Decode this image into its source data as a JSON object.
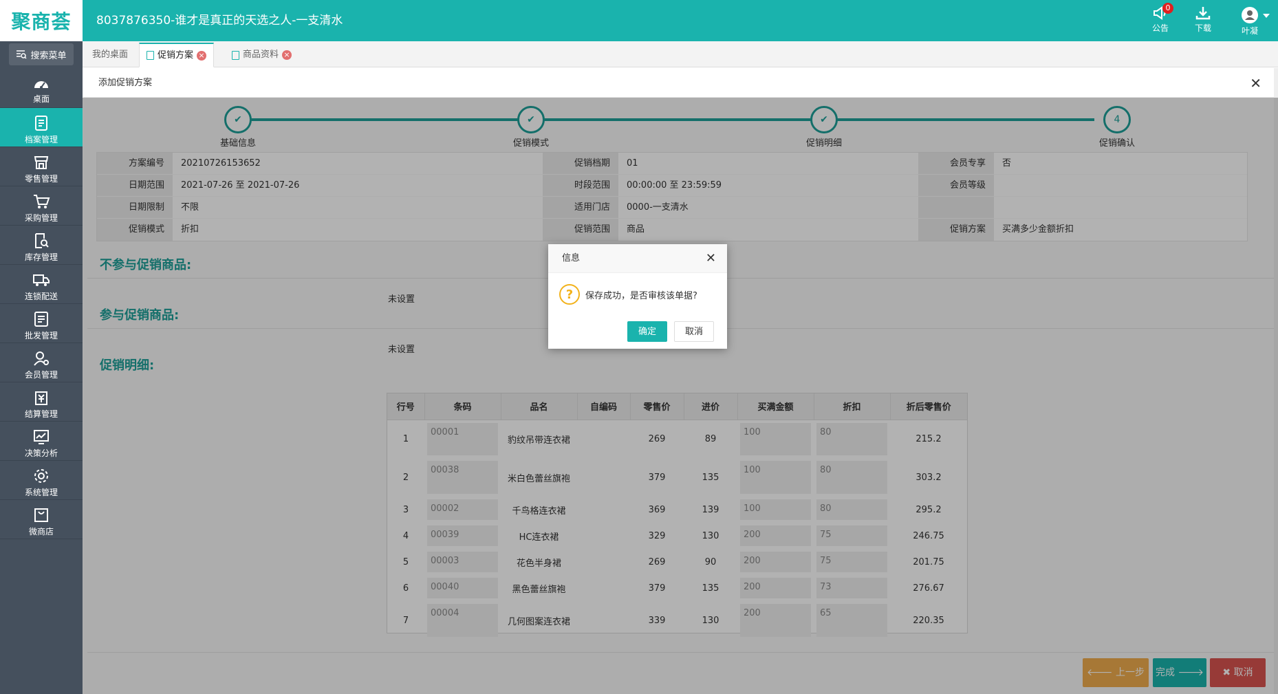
{
  "app": {
    "logo_text": "聚商荟",
    "title": "8037876350-谁才是真正的天选之人-一支清水",
    "announce_label": "公告",
    "announce_count": "0",
    "download_label": "下载",
    "user_name": "叶凝"
  },
  "sidebar": {
    "search_label": "搜索菜单",
    "items": [
      {
        "label": "桌面",
        "icon": "dashboard-icon"
      },
      {
        "label": "档案管理",
        "icon": "archive-icon"
      },
      {
        "label": "零售管理",
        "icon": "store-icon"
      },
      {
        "label": "采购管理",
        "icon": "cart-icon"
      },
      {
        "label": "库存管理",
        "icon": "inventory-icon"
      },
      {
        "label": "连锁配送",
        "icon": "truck-icon"
      },
      {
        "label": "批发管理",
        "icon": "wholesale-icon"
      },
      {
        "label": "会员管理",
        "icon": "member-icon"
      },
      {
        "label": "结算管理",
        "icon": "settlement-icon"
      },
      {
        "label": "决策分析",
        "icon": "analysis-icon"
      },
      {
        "label": "系统管理",
        "icon": "settings-icon"
      },
      {
        "label": "微商店",
        "icon": "shop-bag-icon"
      }
    ]
  },
  "tabs": [
    {
      "label": "我的桌面"
    },
    {
      "label": "促销方案"
    },
    {
      "label": "商品资料"
    }
  ],
  "panel": {
    "title": "添加促销方案",
    "steps": [
      {
        "label": "基础信息",
        "mark": "✔"
      },
      {
        "label": "促销模式",
        "mark": "✔"
      },
      {
        "label": "促销明细",
        "mark": "✔"
      },
      {
        "label": "促销确认",
        "mark": "4"
      }
    ],
    "info": {
      "r1": {
        "l1": "方案编号",
        "v1": "20210726153652",
        "l2": "促销档期",
        "v2": "01",
        "l3": "会员专享",
        "v3": "否"
      },
      "r2": {
        "l1": "日期范围",
        "v1": "2021-07-26 至 2021-07-26",
        "l2": "时段范围",
        "v2": "00:00:00 至 23:59:59",
        "l3": "会员等级",
        "v3": ""
      },
      "r3": {
        "l1": "日期限制",
        "v1": "不限",
        "l2": "适用门店",
        "v2": "0000-一支清水",
        "l3": "",
        "v3": ""
      },
      "r4": {
        "l1": "促销模式",
        "v1": "折扣",
        "l2": "促销范围",
        "v2": "商品",
        "l3": "促销方案",
        "v3": "买满多少金额折扣"
      }
    },
    "excluded_title": "不参与促销商品:",
    "excluded_value": "未设置",
    "included_title": "参与促销商品:",
    "included_value": "未设置",
    "detail_title": "促销明细:",
    "table": {
      "headers": [
        "行号",
        "条码",
        "品名",
        "自编码",
        "零售价",
        "进价",
        "买满金额",
        "折扣",
        "折后零售价"
      ],
      "rows": [
        {
          "no": "1",
          "barcode": "00001",
          "name": "豹纹吊带连衣裙",
          "code": "",
          "retail": "269",
          "cost": "89",
          "min": "100",
          "discount": "80",
          "final": "215.2"
        },
        {
          "no": "2",
          "barcode": "00038",
          "name": "米白色蕾丝旗袍",
          "code": "",
          "retail": "379",
          "cost": "135",
          "min": "100",
          "discount": "80",
          "final": "303.2"
        },
        {
          "no": "3",
          "barcode": "00002",
          "name": "千鸟格连衣裙",
          "code": "",
          "retail": "369",
          "cost": "139",
          "min": "100",
          "discount": "80",
          "final": "295.2"
        },
        {
          "no": "4",
          "barcode": "00039",
          "name": "HC连衣裙",
          "code": "",
          "retail": "329",
          "cost": "130",
          "min": "200",
          "discount": "75",
          "final": "246.75"
        },
        {
          "no": "5",
          "barcode": "00003",
          "name": "花色半身裙",
          "code": "",
          "retail": "269",
          "cost": "90",
          "min": "200",
          "discount": "75",
          "final": "201.75"
        },
        {
          "no": "6",
          "barcode": "00040",
          "name": "黑色蕾丝旗袍",
          "code": "",
          "retail": "379",
          "cost": "135",
          "min": "200",
          "discount": "73",
          "final": "276.67"
        },
        {
          "no": "7",
          "barcode": "00004",
          "name": "几何图案连衣裙",
          "code": "",
          "retail": "339",
          "cost": "130",
          "min": "200",
          "discount": "65",
          "final": "220.35"
        }
      ]
    },
    "buttons": {
      "prev": "上一步",
      "finish": "完成",
      "cancel": "取消"
    }
  },
  "dialog": {
    "title": "信息",
    "message": "保存成功，是否审核该单据?",
    "ok_label": "确定",
    "cancel_label": "取消"
  },
  "colors": {
    "brand": "#1ab3ad",
    "sidebar_bg": "#45505d",
    "step_color": "#1e9f99",
    "prev_button": "#f0ad4e",
    "finish_button": "#1ab3ad",
    "cancel_button": "#d9534f",
    "warning_icon": "#f2b21b"
  }
}
